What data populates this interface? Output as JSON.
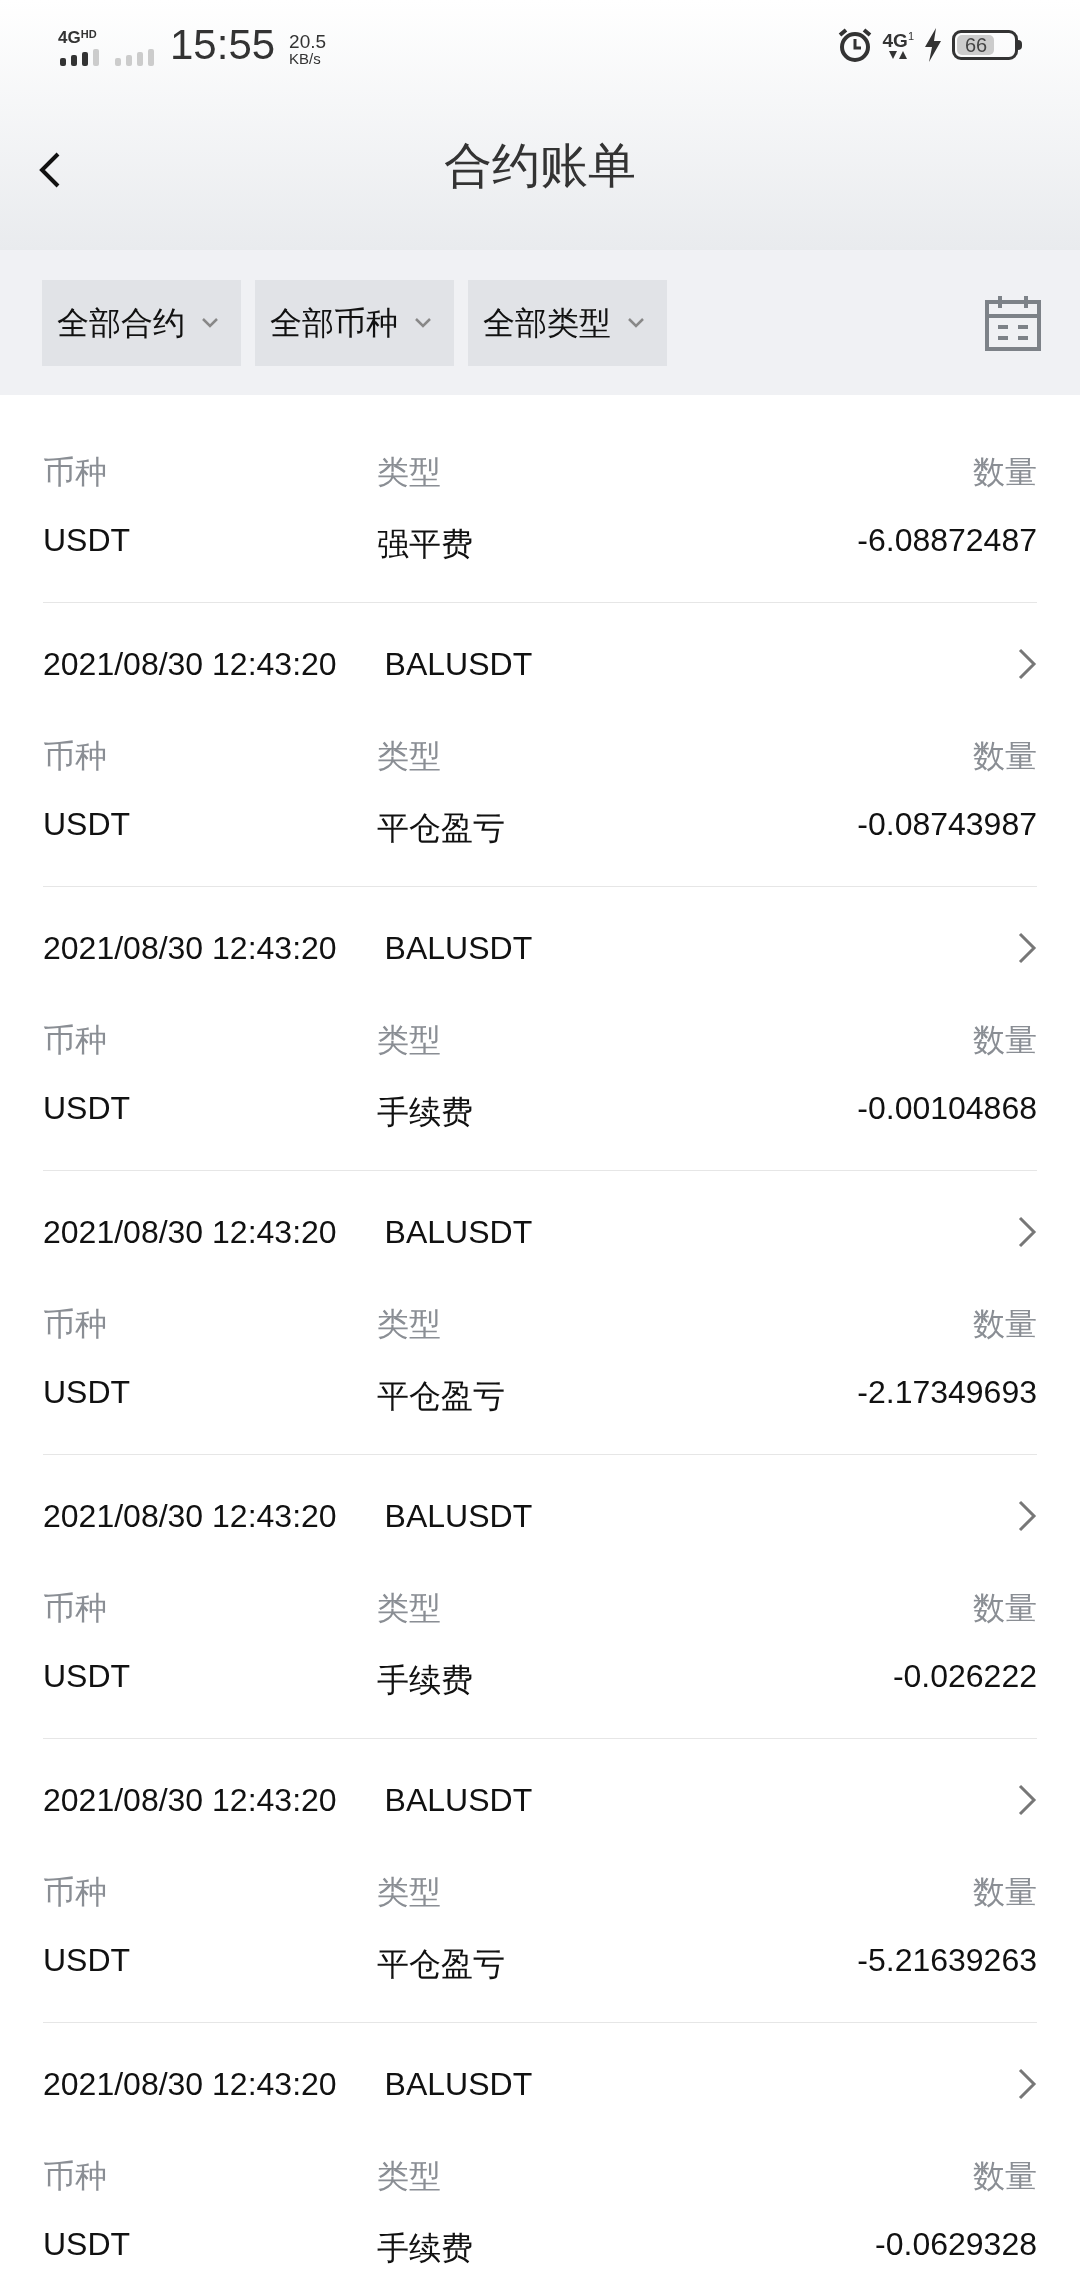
{
  "status_bar": {
    "network": "4G",
    "network_badge": "HD",
    "time": "15:55",
    "speed_value": "20.5",
    "speed_unit": "KB/s",
    "network_right": "4G",
    "sim_slot": "1",
    "battery": "66"
  },
  "header": {
    "title": "合约账单"
  },
  "filters": [
    {
      "label": "全部合约"
    },
    {
      "label": "全部币种"
    },
    {
      "label": "全部类型"
    }
  ],
  "records": [
    {
      "currency_label": "币种",
      "type_label": "类型",
      "amount_label": "数量",
      "currency": "USDT",
      "type": "强平费",
      "amount": "-6.08872487"
    },
    {
      "datetime": "2021/08/30 12:43:20",
      "symbol": "BALUSDT",
      "currency_label": "币种",
      "type_label": "类型",
      "amount_label": "数量",
      "currency": "USDT",
      "type": "平仓盈亏",
      "amount": "-0.08743987"
    },
    {
      "datetime": "2021/08/30 12:43:20",
      "symbol": "BALUSDT",
      "currency_label": "币种",
      "type_label": "类型",
      "amount_label": "数量",
      "currency": "USDT",
      "type": "手续费",
      "amount": "-0.00104868"
    },
    {
      "datetime": "2021/08/30 12:43:20",
      "symbol": "BALUSDT",
      "currency_label": "币种",
      "type_label": "类型",
      "amount_label": "数量",
      "currency": "USDT",
      "type": "平仓盈亏",
      "amount": "-2.17349693"
    },
    {
      "datetime": "2021/08/30 12:43:20",
      "symbol": "BALUSDT",
      "currency_label": "币种",
      "type_label": "类型",
      "amount_label": "数量",
      "currency": "USDT",
      "type": "手续费",
      "amount": "-0.026222"
    },
    {
      "datetime": "2021/08/30 12:43:20",
      "symbol": "BALUSDT",
      "currency_label": "币种",
      "type_label": "类型",
      "amount_label": "数量",
      "currency": "USDT",
      "type": "平仓盈亏",
      "amount": "-5.21639263"
    },
    {
      "datetime": "2021/08/30 12:43:20",
      "symbol": "BALUSDT",
      "currency_label": "币种",
      "type_label": "类型",
      "amount_label": "数量",
      "currency": "USDT",
      "type": "手续费",
      "amount": "-0.0629328"
    }
  ]
}
